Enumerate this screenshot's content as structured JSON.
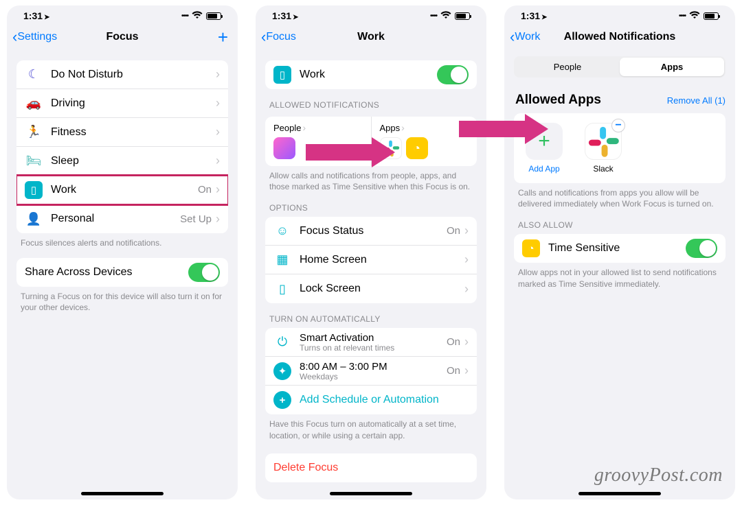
{
  "status": {
    "time": "1:31",
    "loc": "➤"
  },
  "screen1": {
    "back": "Settings",
    "title": "Focus",
    "items": [
      {
        "label": "Do Not Disturb",
        "detail": "",
        "iconColor": "#5856d6",
        "glyph": "☾"
      },
      {
        "label": "Driving",
        "detail": "",
        "iconColor": "#007aff",
        "glyph": "🚗"
      },
      {
        "label": "Fitness",
        "detail": "",
        "iconColor": "#34c759",
        "glyph": "🏃"
      },
      {
        "label": "Sleep",
        "detail": "",
        "iconColor": "#48c7c0",
        "glyph": "🛏"
      },
      {
        "label": "Work",
        "detail": "On",
        "iconColor": "#00b5c9",
        "glyph": "💼",
        "highlight": true
      },
      {
        "label": "Personal",
        "detail": "Set Up",
        "iconColor": "#af52de",
        "glyph": "👤"
      }
    ],
    "footer1": "Focus silences alerts and notifications.",
    "share": "Share Across Devices",
    "footer2": "Turning a Focus on for this device will also turn it on for your other devices."
  },
  "screen2": {
    "back": "Focus",
    "title": "Work",
    "workRow": "Work",
    "allowedHeader": "ALLOWED NOTIFICATIONS",
    "people": "People",
    "apps": "Apps",
    "allowedFooter": "Allow calls and notifications from people, apps, and those marked as Time Sensitive when this Focus is on.",
    "optionsHeader": "OPTIONS",
    "options": [
      {
        "label": "Focus Status",
        "detail": "On"
      },
      {
        "label": "Home Screen",
        "detail": ""
      },
      {
        "label": "Lock Screen",
        "detail": ""
      }
    ],
    "autoHeader": "TURN ON AUTOMATICALLY",
    "smart": {
      "label": "Smart Activation",
      "sub": "Turns on at relevant times",
      "detail": "On"
    },
    "sched": {
      "label": "8:00 AM – 3:00 PM",
      "sub": "Weekdays",
      "detail": "On"
    },
    "addSched": "Add Schedule or Automation",
    "autoFooter": "Have this Focus turn on automatically at a set time, location, or while using a certain app.",
    "delete": "Delete Focus"
  },
  "screen3": {
    "back": "Work",
    "title": "Allowed Notifications",
    "seg": {
      "people": "People",
      "apps": "Apps"
    },
    "allowedApps": "Allowed Apps",
    "removeAll": "Remove All (1)",
    "addApp": "Add App",
    "slack": "Slack",
    "appsFooter": "Calls and notifications from apps you allow will be delivered immediately when Work Focus is turned on.",
    "alsoAllow": "ALSO ALLOW",
    "timeSensitive": "Time Sensitive",
    "tsFooter": "Allow apps not in your allowed list to send notifications marked as Time Sensitive immediately."
  },
  "watermark": "groovyPost.com"
}
